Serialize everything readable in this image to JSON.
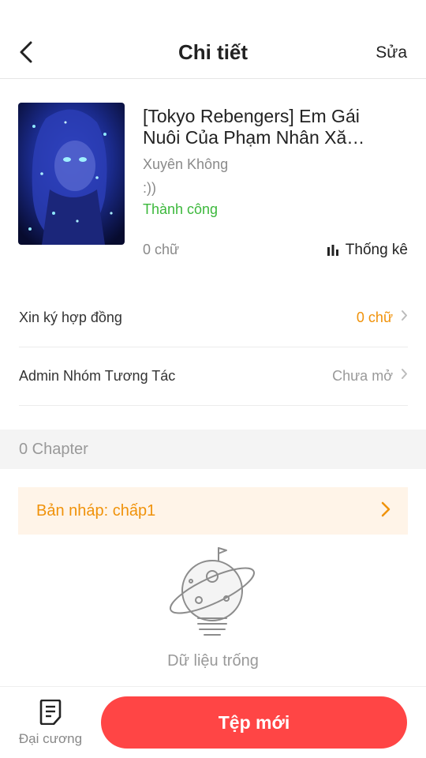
{
  "header": {
    "title": "Chi tiết",
    "edit_label": "Sửa",
    "back_icon": "chevron-left-icon"
  },
  "book": {
    "title": "[Tokyo Rebengers] Em Gái Nuôi Của Phạm Nhân Xăm Rồng",
    "genre": "Xuyên Không",
    "description": ":))",
    "status": "Thành công",
    "word_count": "0 chữ",
    "stats_label": "Thống kê",
    "status_color": "#3cb83c"
  },
  "rows": [
    {
      "label": "Xin ký hợp đồng",
      "value": "0 chữ",
      "value_color": "#f0920a"
    },
    {
      "label": "Admin Nhóm Tương Tác",
      "value": "Chưa mở",
      "value_color": "#999999"
    }
  ],
  "chapters": {
    "count_label": "0 Chapter",
    "draft_label": "Bản nháp: chấp1",
    "empty_label": "Dữ liệu trống"
  },
  "bottom": {
    "outline_label": "Đại cương",
    "new_label": "Tệp mới",
    "accent": "#ff4545"
  }
}
